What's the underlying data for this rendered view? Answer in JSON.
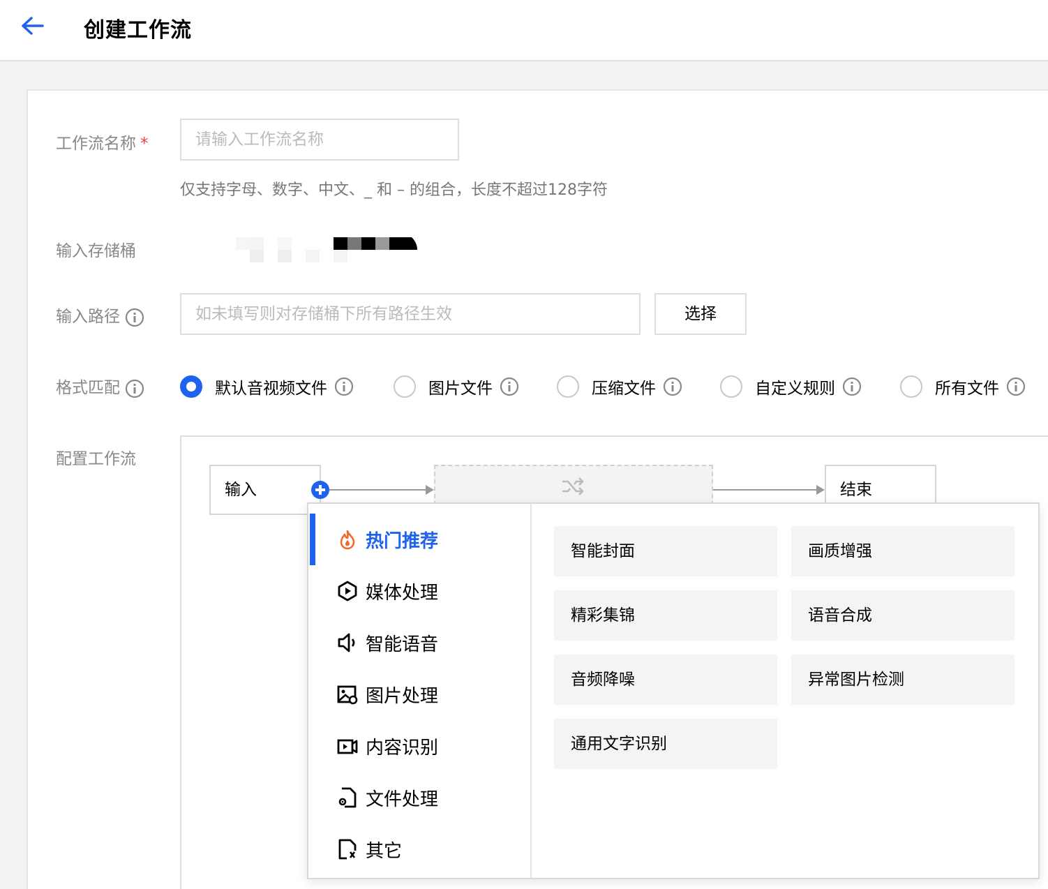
{
  "header": {
    "title": "创建工作流"
  },
  "form": {
    "name": {
      "label": "工作流名称",
      "required_mark": "*",
      "placeholder": "请输入工作流名称",
      "hint": "仅支持字母、数字、中文、_ 和 – 的组合，长度不超过128字符"
    },
    "bucket": {
      "label": "输入存储桶"
    },
    "path": {
      "label": "输入路径",
      "placeholder": "如未填写则对存储桶下所有路径生效",
      "select_label": "选择"
    },
    "format": {
      "label": "格式匹配",
      "options": [
        {
          "label": "默认音视频文件",
          "checked": true
        },
        {
          "label": "图片文件",
          "checked": false
        },
        {
          "label": "压缩文件",
          "checked": false
        },
        {
          "label": "自定义规则",
          "checked": false
        },
        {
          "label": "所有文件",
          "checked": false
        }
      ]
    },
    "workflow": {
      "label": "配置工作流",
      "input_node": "输入",
      "end_node": "结束"
    }
  },
  "dropdown": {
    "categories": [
      {
        "label": "热门推荐",
        "icon": "fire-icon",
        "active": true
      },
      {
        "label": "媒体处理",
        "icon": "media-icon",
        "active": false
      },
      {
        "label": "智能语音",
        "icon": "speaker-icon",
        "active": false
      },
      {
        "label": "图片处理",
        "icon": "image-icon",
        "active": false
      },
      {
        "label": "内容识别",
        "icon": "video-icon",
        "active": false
      },
      {
        "label": "文件处理",
        "icon": "file-gear-icon",
        "active": false
      },
      {
        "label": "其它",
        "icon": "doc-icon",
        "active": false
      }
    ],
    "options": [
      "智能封面",
      "画质增强",
      "精彩集锦",
      "语音合成",
      "音频降噪",
      "异常图片检测",
      "通用文字识别"
    ]
  },
  "colors": {
    "accent": "#1f62ee",
    "required": "#e54545",
    "fire": "#f06a2c"
  }
}
